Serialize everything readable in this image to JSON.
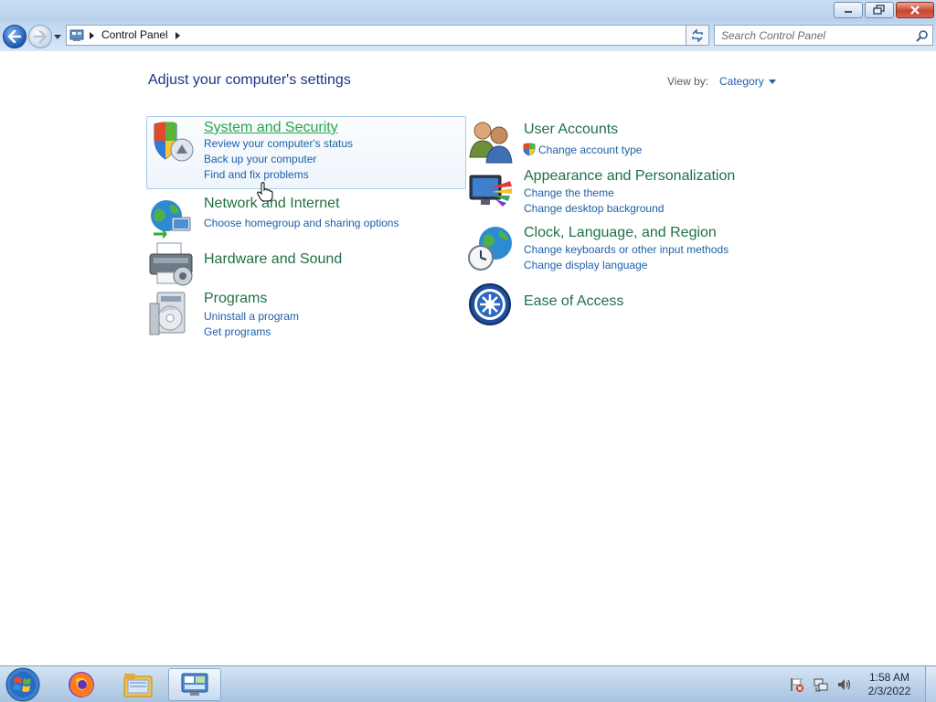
{
  "window": {
    "buttons": {
      "minimize": "minimize-icon",
      "maximize": "restore-icon",
      "close": "close-icon"
    }
  },
  "navbar": {
    "breadcrumb": [
      "Control Panel"
    ],
    "search": {
      "placeholder": "Search Control Panel",
      "value": ""
    }
  },
  "content": {
    "heading": "Adjust your computer's settings",
    "view_by_label": "View by:",
    "view_by_value": "Category",
    "categories": [
      {
        "title": "System and Security",
        "links": [
          "Review your computer's status",
          "Back up your computer",
          "Find and fix problems"
        ],
        "icon": "shield-icon"
      },
      {
        "title": "Network and Internet",
        "links": [
          "Choose homegroup and sharing options"
        ],
        "icon": "network-globe-icon"
      },
      {
        "title": "Hardware and Sound",
        "links": [],
        "icon": "printer-icon"
      },
      {
        "title": "Programs",
        "links": [
          "Uninstall a program",
          "Get programs"
        ],
        "icon": "programs-disc-icon"
      },
      {
        "title": "User Accounts",
        "links": [
          "Change account type"
        ],
        "icon": "users-icon"
      },
      {
        "title": "Appearance and Personalization",
        "links": [
          "Change the theme",
          "Change desktop background"
        ],
        "icon": "monitor-paint-icon"
      },
      {
        "title": "Clock, Language, and Region",
        "links": [
          "Change keyboards or other input methods",
          "Change display language"
        ],
        "icon": "clock-globe-icon"
      },
      {
        "title": "Ease of Access",
        "links": [],
        "icon": "ease-of-access-icon"
      }
    ]
  },
  "taskbar": {
    "items": [
      "windows-start-icon",
      "firefox-icon",
      "file-explorer-icon",
      "control-panel-icon"
    ],
    "clock": {
      "time": "1:58 AM",
      "date": "2/3/2022"
    }
  },
  "colors": {
    "heading": "#1e3287",
    "category_title": "#1e7145",
    "link": "#1e5fa8",
    "hover_title": "#2aa34a"
  }
}
